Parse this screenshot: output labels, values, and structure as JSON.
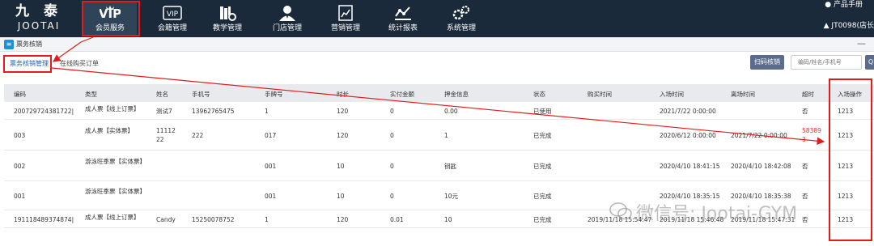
{
  "logo": {
    "cn": "九 泰",
    "en": "JOOTAI"
  },
  "nav": [
    {
      "label": "会员服务",
      "icon": "vip-icon"
    },
    {
      "label": "会籍管理",
      "icon": "vip-card-icon"
    },
    {
      "label": "教学管理",
      "icon": "books-gear-icon"
    },
    {
      "label": "门店管理",
      "icon": "store-person-icon"
    },
    {
      "label": "营销管理",
      "icon": "chart-doc-icon"
    },
    {
      "label": "统计报表",
      "icon": "stats-icon"
    },
    {
      "label": "系统管理",
      "icon": "gears-icon"
    }
  ],
  "top_right": {
    "manual": "产品手册",
    "user": "JT0098(店长"
  },
  "tab": {
    "label": "票务核销",
    "minimize": "—"
  },
  "subtabs": {
    "active": "票务核销管理",
    "other": "在线购买订单"
  },
  "toolbar": {
    "scan_label": "扫码核销",
    "search_placeholder": "编码/姓名/手机号",
    "search_btn": "Q"
  },
  "columns": [
    "编码",
    "类型",
    "姓名",
    "手机号",
    "手牌号",
    "时长",
    "实付金额",
    "押金信息",
    "状态",
    "购买时间",
    "入场时间",
    "离场时间",
    "超时",
    "入场操作"
  ],
  "rows": [
    {
      "code": "200729724381722|",
      "type": "成人票【线上订票】",
      "name": "测试7",
      "phone": "13962765475",
      "hand": "1",
      "dur": "120",
      "paid": "0",
      "deposit": "0.00",
      "status": "已使用",
      "buy": "",
      "in": "2021/7/22 0:00:00",
      "out": "",
      "over": "否",
      "op": "1213"
    },
    {
      "code": "003",
      "type": "成人票【实体票】",
      "name": "11112 22",
      "phone": "222",
      "hand": "017",
      "dur": "120",
      "paid": "0",
      "deposit": "1",
      "status": "已完成",
      "buy": "",
      "in": "2020/6/12 0:00:00",
      "out": "2021/7/22 0:00:00",
      "over": "58389 3",
      "op": "1213"
    },
    {
      "code": "002",
      "type": "游泳旺季票【实体票】",
      "name": "",
      "phone": "",
      "hand": "001",
      "dur": "10",
      "paid": "0",
      "deposit": "钥匙",
      "status": "已完成",
      "buy": "",
      "in": "2020/4/10 18:41:15",
      "out": "2020/4/10 18:42:08",
      "over": "否",
      "op": "1213"
    },
    {
      "code": "001",
      "type": "游泳旺季票【实体票】",
      "name": "",
      "phone": "",
      "hand": "001",
      "dur": "10",
      "paid": "0",
      "deposit": "10元",
      "status": "已完成",
      "buy": "",
      "in": "2020/4/10 18:35:15",
      "out": "2020/4/10 18:35:38",
      "over": "否",
      "op": "1213"
    },
    {
      "code": "191118489374874|",
      "type": "成人票【线上订票】",
      "name": "Candy",
      "phone": "15250078752",
      "hand": "1",
      "dur": "120",
      "paid": "0.01",
      "deposit": "10",
      "status": "已完成",
      "buy": "2019/11/18 15:54:47",
      "in": "2019/11/18 15:46:48",
      "out": "2019/11/18 15:47:31",
      "over": "否",
      "op": "1213"
    }
  ],
  "watermark": "微信号: Jootai-GYM",
  "colors": {
    "topbar": "#1b2a3a",
    "highlight": "#e21b1b",
    "link": "#1e63b8",
    "button": "#5a6b8c"
  }
}
